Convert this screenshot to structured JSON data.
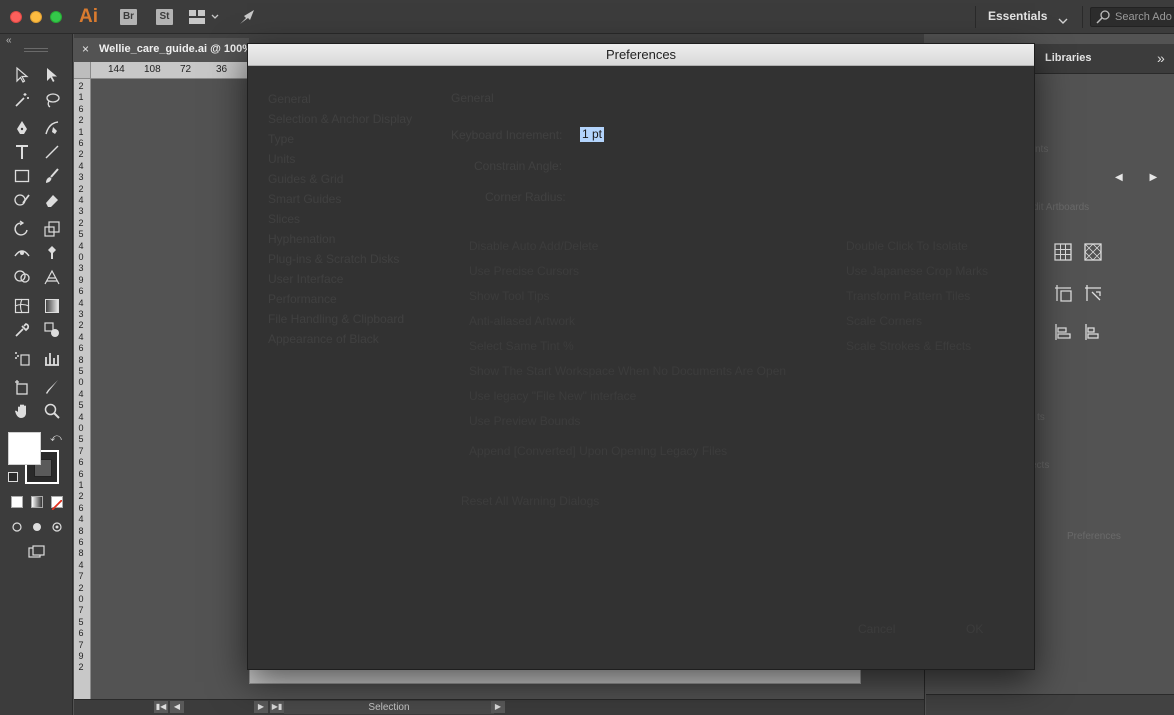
{
  "app": {
    "logo": "Ai",
    "bridge_btn": "Br",
    "stock_btn": "St",
    "workspace": "Essentials",
    "search_placeholder": "Search Ado"
  },
  "document": {
    "tab_name": "Wellie_care_guide.ai @ 100%",
    "close_glyph": "×",
    "status_mode": "Selection"
  },
  "ruler": {
    "h_labels": [
      "144",
      "108",
      "72",
      "36"
    ],
    "v_digits": [
      "2",
      "1",
      "6",
      "2",
      "1",
      "6",
      "2",
      "4",
      "3",
      "2",
      "4",
      "3",
      "2",
      "5",
      "4",
      "0",
      "3",
      "9",
      "6",
      "4",
      "3",
      "2",
      "4",
      "6",
      "8",
      "5",
      "0",
      "4",
      "5",
      "4",
      "0",
      "5",
      "7",
      "6",
      "6",
      "1",
      "2",
      "6",
      "4",
      "8",
      "6",
      "8",
      "4",
      "7",
      "2",
      "0",
      "7",
      "5",
      "6",
      "7",
      "9",
      "2"
    ]
  },
  "right_panel": {
    "tab_label": "Libraries",
    "faint_labels": [
      "nts",
      "dit Artboards",
      "ts",
      "ects",
      "Preferences"
    ]
  },
  "dialog": {
    "title": "Preferences",
    "nav": [
      "General",
      "Selection & Anchor Display",
      "Type",
      "Units",
      "Guides & Grid",
      "Smart Guides",
      "Slices",
      "Hyphenation",
      "Plug-ins & Scratch Disks",
      "User Interface",
      "Performance",
      "File Handling & Clipboard",
      "Appearance of Black"
    ],
    "section_title": "General",
    "keyboard_increment_label": "Keyboard Increment:",
    "keyboard_increment_value": "1 pt",
    "constrain_angle_label": "Constrain Angle:",
    "corner_radius_label": "Corner Radius:",
    "options_left": [
      "Disable Auto Add/Delete",
      "Use Precise Cursors",
      "Show Tool Tips",
      "Anti-aliased Artwork",
      "Select Same Tint %",
      "Show The Start Workspace When No Documents Are Open",
      "Use legacy \"File New\" interface",
      "Use Preview Bounds"
    ],
    "options_right": [
      "Double Click To Isolate",
      "Use Japanese Crop Marks",
      "Transform Pattern Tiles",
      "Scale Corners",
      "Scale Strokes & Effects"
    ],
    "append_converted": "Append [Converted] Upon Opening Legacy Files",
    "reset_warnings": "Reset All Warning Dialogs",
    "cancel": "Cancel",
    "ok": "OK"
  },
  "colors": {
    "accent_ai": "#d97b2f",
    "selection_highlight": "#b3d4fc",
    "dialog_bg": "#323232"
  }
}
